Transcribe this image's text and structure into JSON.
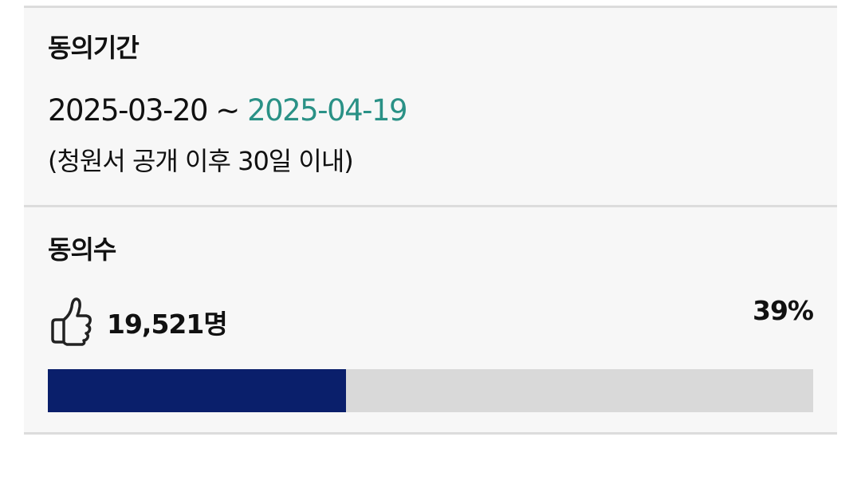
{
  "period": {
    "heading": "동의기간",
    "start": "2025-03-20",
    "separator": " ~ ",
    "end": "2025-04-19",
    "note": "(청원서 공개 이후 30일 이내)"
  },
  "count": {
    "heading": "동의수",
    "icon": "thumbs-up-icon",
    "value": "19,521명",
    "percent_label": "39%",
    "progress_fraction": 0.39
  },
  "colors": {
    "accent": "#2a9186",
    "progress_fill": "#0a1f6b",
    "progress_track": "#d9d9d9",
    "card_background": "#f7f7f7"
  }
}
